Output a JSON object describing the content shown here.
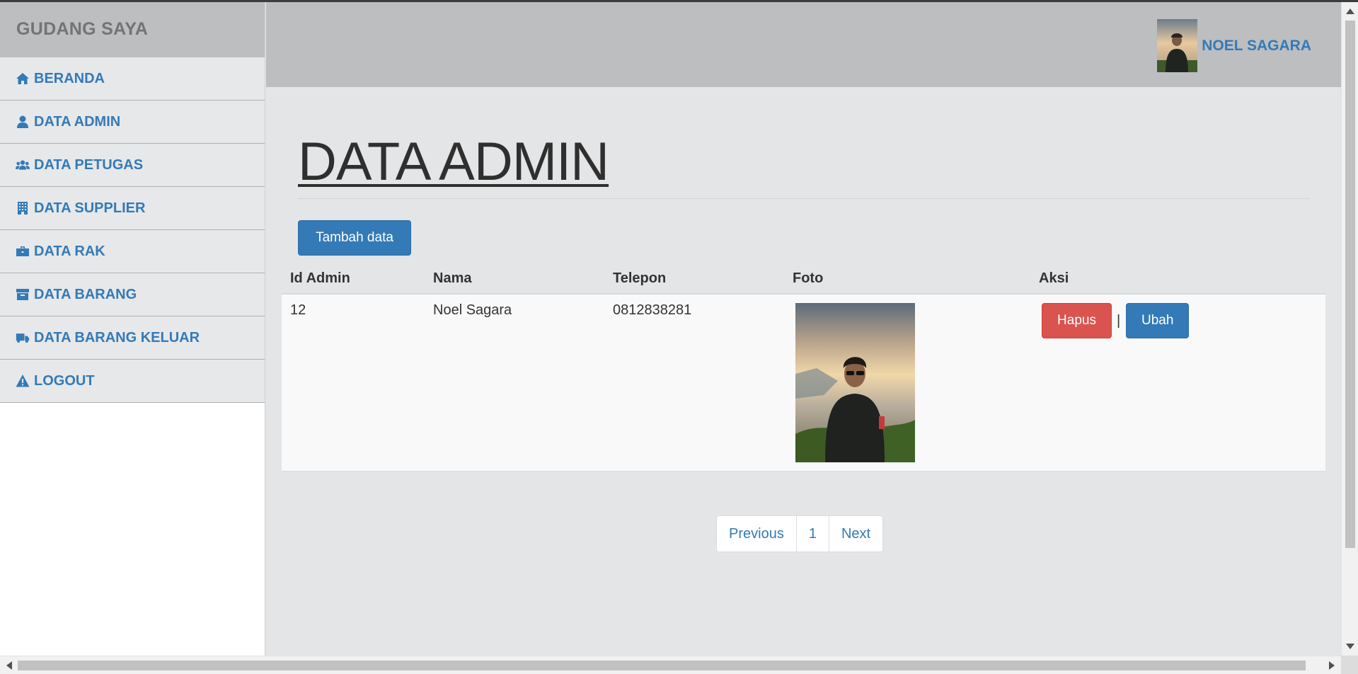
{
  "app": {
    "brand": "GUDANG SAYA"
  },
  "sidebar": {
    "items": [
      {
        "label": "BERANDA",
        "icon": "home-icon"
      },
      {
        "label": "DATA ADMIN",
        "icon": "user-icon"
      },
      {
        "label": "DATA PETUGAS",
        "icon": "users-icon"
      },
      {
        "label": "DATA SUPPLIER",
        "icon": "building-icon"
      },
      {
        "label": "DATA RAK",
        "icon": "briefcase-icon"
      },
      {
        "label": "DATA BARANG",
        "icon": "archive-icon"
      },
      {
        "label": "DATA BARANG KELUAR",
        "icon": "truck-icon"
      },
      {
        "label": "LOGOUT",
        "icon": "warning-icon"
      }
    ]
  },
  "header": {
    "user_name": "NOEL SAGARA"
  },
  "main": {
    "title": "DATA ADMIN",
    "add_button": "Tambah data",
    "table": {
      "columns": [
        "Id Admin",
        "Nama",
        "Telepon",
        "Foto",
        "Aksi"
      ],
      "rows": [
        {
          "id": "12",
          "nama": "Noel Sagara",
          "telepon": "0812838281",
          "foto": "admin-photo"
        }
      ]
    },
    "actions": {
      "delete": "Hapus",
      "separator": "|",
      "edit": "Ubah"
    },
    "pagination": {
      "previous": "Previous",
      "page": "1",
      "next": "Next"
    }
  },
  "colors": {
    "accent": "#337ab7",
    "danger": "#d9534f",
    "header_bg": "#bdbec0",
    "content_bg": "#e4e5e7"
  }
}
